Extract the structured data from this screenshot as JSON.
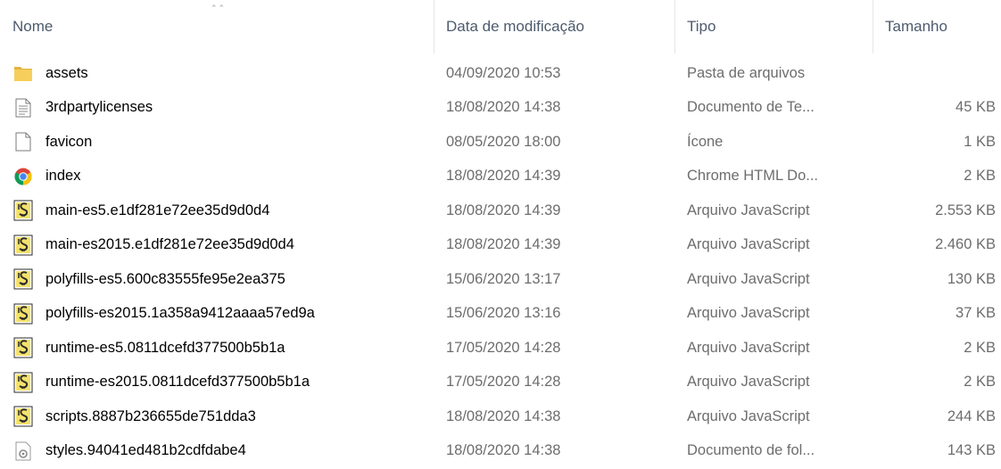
{
  "columns": {
    "name": "Nome",
    "date": "Data de modificação",
    "type": "Tipo",
    "size": "Tamanho"
  },
  "files": [
    {
      "name": "assets",
      "date": "04/09/2020 10:53",
      "type": "Pasta de arquivos",
      "size": "",
      "icon": "folder-icon"
    },
    {
      "name": "3rdpartylicenses",
      "date": "18/08/2020 14:38",
      "type": "Documento de Te...",
      "size": "45 KB",
      "icon": "text-document-icon"
    },
    {
      "name": "favicon",
      "date": "08/05/2020 18:00",
      "type": "Ícone",
      "size": "1 KB",
      "icon": "blank-file-icon"
    },
    {
      "name": "index",
      "date": "18/08/2020 14:39",
      "type": "Chrome HTML Do...",
      "size": "2 KB",
      "icon": "chrome-icon"
    },
    {
      "name": "main-es5.e1df281e72ee35d9d0d4",
      "date": "18/08/2020 14:39",
      "type": "Arquivo JavaScript",
      "size": "2.553 KB",
      "icon": "javascript-file-icon"
    },
    {
      "name": "main-es2015.e1df281e72ee35d9d0d4",
      "date": "18/08/2020 14:39",
      "type": "Arquivo JavaScript",
      "size": "2.460 KB",
      "icon": "javascript-file-icon"
    },
    {
      "name": "polyfills-es5.600c83555fe95e2ea375",
      "date": "15/06/2020 13:17",
      "type": "Arquivo JavaScript",
      "size": "130 KB",
      "icon": "javascript-file-icon"
    },
    {
      "name": "polyfills-es2015.1a358a9412aaaa57ed9a",
      "date": "15/06/2020 13:16",
      "type": "Arquivo JavaScript",
      "size": "37 KB",
      "icon": "javascript-file-icon"
    },
    {
      "name": "runtime-es5.0811dcefd377500b5b1a",
      "date": "17/05/2020 14:28",
      "type": "Arquivo JavaScript",
      "size": "2 KB",
      "icon": "javascript-file-icon"
    },
    {
      "name": "runtime-es2015.0811dcefd377500b5b1a",
      "date": "17/05/2020 14:28",
      "type": "Arquivo JavaScript",
      "size": "2 KB",
      "icon": "javascript-file-icon"
    },
    {
      "name": "scripts.8887b236655de751dda3",
      "date": "18/08/2020 14:38",
      "type": "Arquivo JavaScript",
      "size": "244 KB",
      "icon": "javascript-file-icon"
    },
    {
      "name": "styles.94041ed481b2cdfdabe4",
      "date": "18/08/2020 14:38",
      "type": "Documento de fol...",
      "size": "143 KB",
      "icon": "stylesheet-file-icon"
    }
  ],
  "colors": {
    "header_text": "#4d5b6e",
    "secondary_text": "#6d6d6d",
    "folder": "#f3c548",
    "js_icon": "#e9d84a"
  }
}
